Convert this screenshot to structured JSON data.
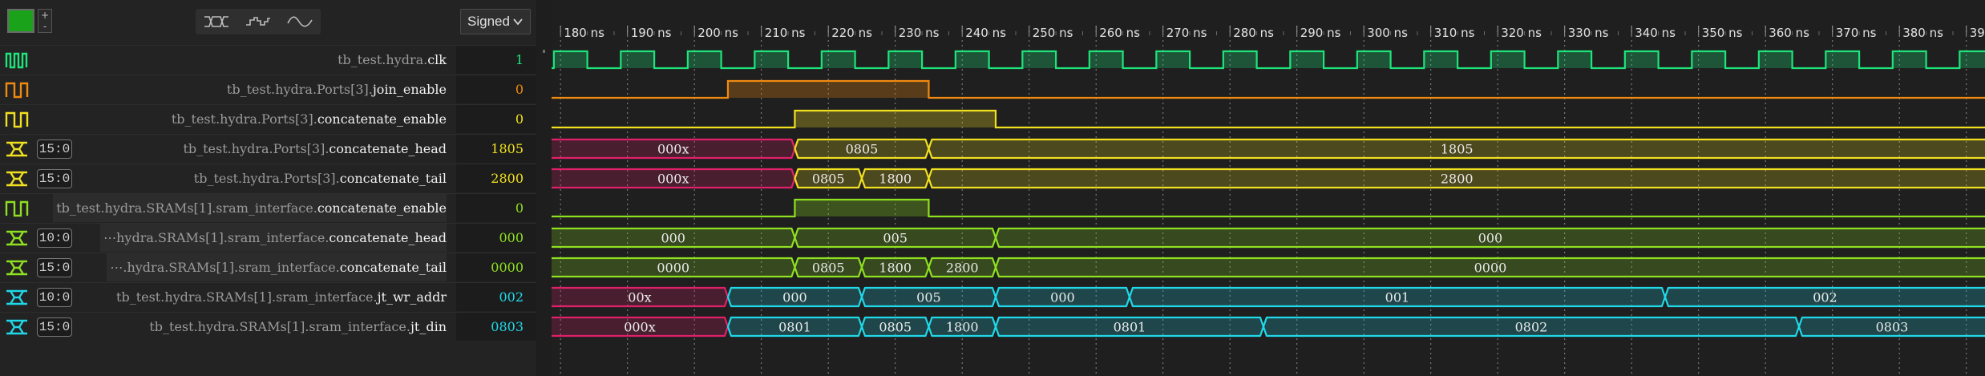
{
  "toolbar": {
    "color_swatch": "#1aa21a",
    "zoom_in_label": "+",
    "zoom_out_label": "-",
    "style_buttons": [
      "digital-style-icon",
      "analog-step-icon",
      "analog-smooth-icon"
    ],
    "format_select": {
      "selected": "Signed"
    }
  },
  "signals": [
    {
      "icon": "clock",
      "color": "#1ee47a",
      "width_label": "",
      "dim": "tb_test.hydra.",
      "hi": "clk",
      "value": "1"
    },
    {
      "icon": "bit",
      "color": "#f08a10",
      "width_label": "",
      "dim": "tb_test.hydra.Ports[3].",
      "hi": "join_enable",
      "value": "0"
    },
    {
      "icon": "bit",
      "color": "#f0e020",
      "width_label": "",
      "dim": "tb_test.hydra.Ports[3].",
      "hi": "concatenate_enable",
      "value": "0"
    },
    {
      "icon": "bus",
      "color": "#f0e020",
      "width_label": "15:0",
      "dim": "tb_test.hydra.Ports[3].",
      "hi": "concatenate_head",
      "value": "1805"
    },
    {
      "icon": "bus",
      "color": "#f0e020",
      "width_label": "15:0",
      "dim": "tb_test.hydra.Ports[3].",
      "hi": "concatenate_tail",
      "value": "2800"
    },
    {
      "icon": "bit",
      "color": "#8ee020",
      "width_label": "",
      "dim": "tb_test.hydra.SRAMs[1].sram_interface.",
      "hi": "concatenate_enable",
      "value": "0",
      "highlight": true
    },
    {
      "icon": "bus",
      "color": "#8ee020",
      "width_label": "10:0",
      "dim": "⋯hydra.SRAMs[1].sram_interface.",
      "hi": "concatenate_head",
      "value": "000",
      "highlight": true
    },
    {
      "icon": "bus",
      "color": "#8ee020",
      "width_label": "15:0",
      "dim": "⋯.hydra.SRAMs[1].sram_interface.",
      "hi": "concatenate_tail",
      "value": "0000",
      "highlight": true
    },
    {
      "icon": "bus",
      "color": "#20d8e8",
      "width_label": "10:0",
      "dim": "tb_test.hydra.SRAMs[1].sram_interface.",
      "hi": "jt_wr_addr",
      "value": "002"
    },
    {
      "icon": "bus",
      "color": "#20d8e8",
      "width_label": "15:0",
      "dim": "tb_test.hydra.SRAMs[1].sram_interface.",
      "hi": "jt_din",
      "value": "0803"
    }
  ],
  "timeline": {
    "tick_labels": [
      "180 ns",
      "190 ns",
      "200 ns",
      "210 ns",
      "220 ns",
      "230 ns",
      "240 ns",
      "250 ns",
      "260 ns",
      "270 ns",
      "280 ns",
      "290 ns",
      "300 ns",
      "310 ns",
      "320 ns",
      "330 ns",
      "340 ns",
      "350 ns",
      "360 ns",
      "370 ns",
      "380 ns",
      "390 ns"
    ],
    "tick_start_ns": 180,
    "tick_step_ns": 10
  },
  "waveforms": {
    "view_start_ns": 178.3,
    "view_end_ns": 393.0,
    "clk": {
      "period_ns": 10,
      "first_rise_ns": 179,
      "value_at_start": 1
    },
    "join_enable": {
      "high_from_ns": 205,
      "high_to_ns": 235
    },
    "concatenate_enable": {
      "high_from_ns": 215,
      "high_to_ns": 245
    },
    "concatenate_head": [
      {
        "from": 178.3,
        "to": 215,
        "label": "000x",
        "invalid": true
      },
      {
        "from": 215,
        "to": 235,
        "label": "0805"
      },
      {
        "from": 235,
        "to": 393,
        "label": "1805"
      }
    ],
    "concatenate_tail": [
      {
        "from": 178.3,
        "to": 215,
        "label": "000x",
        "invalid": true
      },
      {
        "from": 215,
        "to": 225,
        "label": "0805"
      },
      {
        "from": 225,
        "to": 235,
        "label": "1800"
      },
      {
        "from": 235,
        "to": 393,
        "label": "2800"
      }
    ],
    "sram_concatenate_enable": {
      "high_from_ns": 215,
      "high_to_ns": 235
    },
    "sram_concatenate_head": [
      {
        "from": 178.3,
        "to": 215,
        "label": "000"
      },
      {
        "from": 215,
        "to": 245,
        "label": "005"
      },
      {
        "from": 245,
        "to": 393,
        "label": "000"
      }
    ],
    "sram_concatenate_tail": [
      {
        "from": 178.3,
        "to": 215,
        "label": "0000"
      },
      {
        "from": 215,
        "to": 225,
        "label": "0805"
      },
      {
        "from": 225,
        "to": 235,
        "label": "1800"
      },
      {
        "from": 235,
        "to": 245,
        "label": "2800"
      },
      {
        "from": 245,
        "to": 393,
        "label": "0000"
      }
    ],
    "jt_wr_addr": [
      {
        "from": 178.3,
        "to": 205,
        "label": "00x",
        "invalid": true
      },
      {
        "from": 205,
        "to": 225,
        "label": "000"
      },
      {
        "from": 225,
        "to": 245,
        "label": "005"
      },
      {
        "from": 245,
        "to": 265,
        "label": "000"
      },
      {
        "from": 265,
        "to": 345,
        "label": "001"
      },
      {
        "from": 345,
        "to": 393,
        "label": "002"
      }
    ],
    "jt_din": [
      {
        "from": 178.3,
        "to": 205,
        "label": "000x",
        "invalid": true
      },
      {
        "from": 205,
        "to": 225,
        "label": "0801"
      },
      {
        "from": 225,
        "to": 235,
        "label": "0805"
      },
      {
        "from": 235,
        "to": 245,
        "label": "1800"
      },
      {
        "from": 245,
        "to": 285,
        "label": "0801"
      },
      {
        "from": 285,
        "to": 365,
        "label": "0802"
      },
      {
        "from": 365,
        "to": 393,
        "label": "0803"
      }
    ]
  },
  "colors": {
    "invalid": "#e0206a",
    "cursor_handle": "#6a6a6a"
  }
}
